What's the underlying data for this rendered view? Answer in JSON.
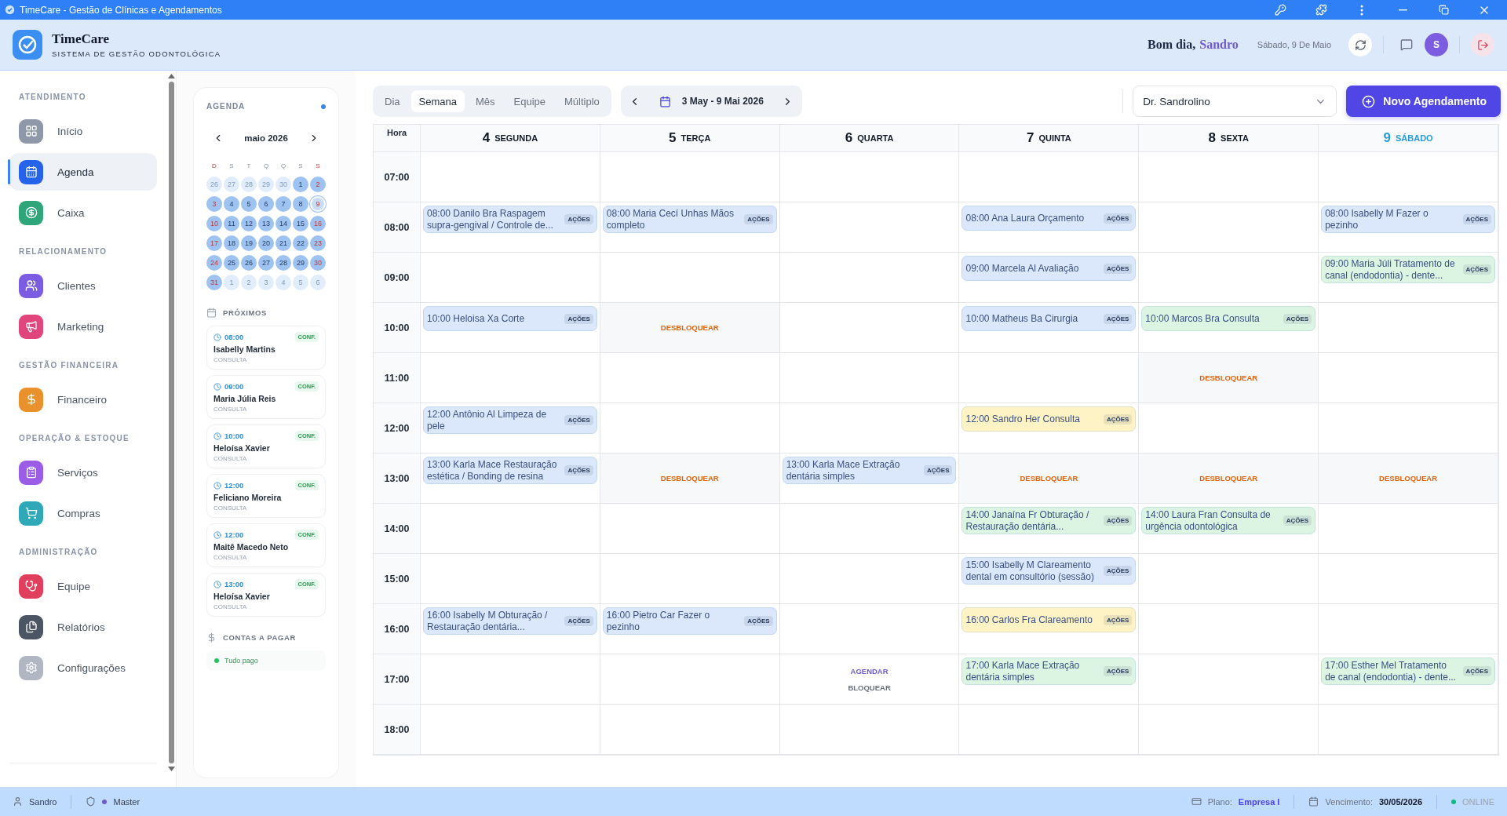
{
  "window": {
    "title": "TimeCare - Gestão de Clínicas e Agendamentos"
  },
  "header": {
    "app_name": "TimeCare",
    "subtitle": "SISTEMA DE GESTÃO ODONTOLÓGICA",
    "greeting": "Bom dia,",
    "user_name": "Sandro",
    "date": "Sábado, 9 De Maio",
    "avatar_initial": "S"
  },
  "sidebar": {
    "sections": [
      {
        "label": "ATENDIMENTO",
        "items": [
          {
            "label": "Início",
            "color": "#8e98a8",
            "selected": false
          },
          {
            "label": "Agenda",
            "color": "#2563eb",
            "selected": true
          },
          {
            "label": "Caixa",
            "color": "#2fa67a",
            "selected": false
          }
        ]
      },
      {
        "label": "RELACIONAMENTO",
        "items": [
          {
            "label": "Clientes",
            "color": "#7c5ce0",
            "selected": false
          },
          {
            "label": "Marketing",
            "color": "#e0457b",
            "selected": false
          }
        ]
      },
      {
        "label": "GESTÃO FINANCEIRA",
        "items": [
          {
            "label": "Financeiro",
            "color": "#e8912d",
            "selected": false
          }
        ]
      },
      {
        "label": "OPERAÇÃO & ESTOQUE",
        "items": [
          {
            "label": "Serviços",
            "color": "#9b5de5",
            "selected": false
          },
          {
            "label": "Compras",
            "color": "#2fa8b8",
            "selected": false
          }
        ]
      },
      {
        "label": "ADMINISTRAÇÃO",
        "items": [
          {
            "label": "Equipe",
            "color": "#e0405e",
            "selected": false
          },
          {
            "label": "Relatórios",
            "color": "#4b5563",
            "selected": false
          },
          {
            "label": "Configurações",
            "color": "#b0b7c3",
            "selected": false
          }
        ]
      }
    ]
  },
  "agenda_panel": {
    "title": "AGENDA",
    "month": "maio 2026",
    "weekdays": [
      "D",
      "S",
      "T",
      "Q",
      "Q",
      "S",
      "S"
    ],
    "weeks": [
      [
        {
          "day": "26",
          "muted": true,
          "selected": false
        },
        {
          "day": "27",
          "muted": true,
          "selected": false
        },
        {
          "day": "28",
          "muted": true,
          "selected": false
        },
        {
          "day": "29",
          "muted": true,
          "selected": false
        },
        {
          "day": "30",
          "muted": true,
          "selected": false
        },
        {
          "day": "1",
          "muted": false,
          "selected": false
        },
        {
          "day": "2",
          "muted": false,
          "selected": false
        }
      ],
      [
        {
          "day": "3",
          "muted": false,
          "selected": false
        },
        {
          "day": "4",
          "muted": false,
          "selected": false
        },
        {
          "day": "5",
          "muted": false,
          "selected": false
        },
        {
          "day": "6",
          "muted": false,
          "selected": false
        },
        {
          "day": "7",
          "muted": false,
          "selected": false
        },
        {
          "day": "8",
          "muted": false,
          "selected": false
        },
        {
          "day": "9",
          "muted": false,
          "selected": true
        }
      ],
      [
        {
          "day": "10",
          "muted": false,
          "selected": false
        },
        {
          "day": "11",
          "muted": false,
          "selected": false
        },
        {
          "day": "12",
          "muted": false,
          "selected": false
        },
        {
          "day": "13",
          "muted": false,
          "selected": false
        },
        {
          "day": "14",
          "muted": false,
          "selected": false
        },
        {
          "day": "15",
          "muted": false,
          "selected": false
        },
        {
          "day": "16",
          "muted": false,
          "selected": false
        }
      ],
      [
        {
          "day": "17",
          "muted": false,
          "selected": false
        },
        {
          "day": "18",
          "muted": false,
          "selected": false
        },
        {
          "day": "19",
          "muted": false,
          "selected": false
        },
        {
          "day": "20",
          "muted": false,
          "selected": false
        },
        {
          "day": "21",
          "muted": false,
          "selected": false
        },
        {
          "day": "22",
          "muted": false,
          "selected": false
        },
        {
          "day": "23",
          "muted": false,
          "selected": false
        }
      ],
      [
        {
          "day": "24",
          "muted": false,
          "selected": false
        },
        {
          "day": "25",
          "muted": false,
          "selected": false
        },
        {
          "day": "26",
          "muted": false,
          "selected": false
        },
        {
          "day": "27",
          "muted": false,
          "selected": false
        },
        {
          "day": "28",
          "muted": false,
          "selected": false
        },
        {
          "day": "29",
          "muted": false,
          "selected": false
        },
        {
          "day": "30",
          "muted": false,
          "selected": false
        }
      ],
      [
        {
          "day": "31",
          "muted": false,
          "selected": false
        },
        {
          "day": "1",
          "muted": true,
          "selected": false
        },
        {
          "day": "2",
          "muted": true,
          "selected": false
        },
        {
          "day": "3",
          "muted": true,
          "selected": false
        },
        {
          "day": "4",
          "muted": true,
          "selected": false
        },
        {
          "day": "5",
          "muted": true,
          "selected": false
        },
        {
          "day": "6",
          "muted": true,
          "selected": false
        }
      ]
    ],
    "upcoming_title": "PRÓXIMOS",
    "upcoming": [
      {
        "time": "08:00",
        "status": "CONF.",
        "name": "Isabelly Martins",
        "type": "CONSULTA"
      },
      {
        "time": "09:00",
        "status": "CONF.",
        "name": "Maria Júlia Reis",
        "type": "CONSULTA"
      },
      {
        "time": "10:00",
        "status": "CONF.",
        "name": "Heloísa Xavier",
        "type": "CONSULTA"
      },
      {
        "time": "12:00",
        "status": "CONF.",
        "name": "Feliciano Moreira",
        "type": "CONSULTA"
      },
      {
        "time": "12:00",
        "status": "CONF.",
        "name": "Maitê Macedo Neto",
        "type": "CONSULTA"
      },
      {
        "time": "13:00",
        "status": "CONF.",
        "name": "Heloísa Xavier",
        "type": "CONSULTA"
      }
    ],
    "bills_title": "CONTAS A PAGAR",
    "bills_status": "Tudo pago"
  },
  "toolbar": {
    "views": [
      {
        "label": "Dia",
        "selected": false
      },
      {
        "label": "Semana",
        "selected": true
      },
      {
        "label": "Mês",
        "selected": false
      },
      {
        "label": "Equipe",
        "selected": false
      },
      {
        "label": "Múltiplo",
        "selected": false
      }
    ],
    "date_range": "3 May - 9 Mai 2026",
    "professional": "Dr. Sandrolino",
    "new_button": "Novo Agendamento"
  },
  "calendar": {
    "hour_header": "Hora",
    "days": [
      {
        "number": "4",
        "name": "SEGUNDA",
        "selected": false
      },
      {
        "number": "5",
        "name": "TERÇA",
        "selected": false
      },
      {
        "number": "6",
        "name": "QUARTA",
        "selected": false
      },
      {
        "number": "7",
        "name": "QUINTA",
        "selected": false
      },
      {
        "number": "8",
        "name": "SEXTA",
        "selected": false
      },
      {
        "number": "9",
        "name": "SÁBADO",
        "selected": true
      }
    ],
    "rows": [
      {
        "hour": "07:00",
        "cells": [
          {
            "kind": "empty"
          },
          {
            "kind": "empty"
          },
          {
            "kind": "empty"
          },
          {
            "kind": "empty"
          },
          {
            "kind": "empty"
          },
          {
            "kind": "empty"
          }
        ]
      },
      {
        "hour": "08:00",
        "cells": [
          {
            "kind": "appointment",
            "text": "08:00 Danilo Bra Raspagem supra-gengival / Controle de...",
            "action": "AÇÕES",
            "color": "#dbe8fb"
          },
          {
            "kind": "appointment",
            "text": "08:00 Maria Cecí Unhas Mãos completo",
            "action": "AÇÕES",
            "color": "#dbe8fb"
          },
          {
            "kind": "empty"
          },
          {
            "kind": "appointment",
            "text": "08:00 Ana Laura Orçamento",
            "action": "AÇÕES",
            "color": "#dbe8fb"
          },
          {
            "kind": "empty"
          },
          {
            "kind": "appointment",
            "text": "08:00 Isabelly M Fazer o pezinho",
            "action": "AÇÕES",
            "color": "#dbe8fb"
          }
        ]
      },
      {
        "hour": "09:00",
        "cells": [
          {
            "kind": "empty"
          },
          {
            "kind": "empty"
          },
          {
            "kind": "empty"
          },
          {
            "kind": "appointment",
            "text": "09:00 Marcela Al Avaliação",
            "action": "AÇÕES",
            "color": "#dbe8fb"
          },
          {
            "kind": "empty"
          },
          {
            "kind": "appointment",
            "text": "09:00 Maria Júli Tratamento de canal (endodontia) - dente...",
            "action": "AÇÕES",
            "color": "#dcf5e3"
          }
        ]
      },
      {
        "hour": "10:00",
        "cells": [
          {
            "kind": "appointment",
            "text": "10:00 Heloisa Xa Corte",
            "action": "AÇÕES",
            "color": "#dbe8fb"
          },
          {
            "kind": "blocked",
            "action": "DESBLOQUEAR"
          },
          {
            "kind": "empty"
          },
          {
            "kind": "appointment",
            "text": "10:00 Matheus Ba Cirurgia",
            "action": "AÇÕES",
            "color": "#dbe8fb"
          },
          {
            "kind": "appointment",
            "text": "10:00 Marcos Bra Consulta",
            "action": "AÇÕES",
            "color": "#dcf5e3"
          },
          {
            "kind": "empty"
          }
        ]
      },
      {
        "hour": "11:00",
        "cells": [
          {
            "kind": "empty"
          },
          {
            "kind": "empty"
          },
          {
            "kind": "empty"
          },
          {
            "kind": "empty"
          },
          {
            "kind": "blocked",
            "action": "DESBLOQUEAR"
          },
          {
            "kind": "empty"
          }
        ]
      },
      {
        "hour": "12:00",
        "cells": [
          {
            "kind": "appointment",
            "text": "12:00 Antônio Al Limpeza de pele",
            "action": "AÇÕES",
            "color": "#dbe8fb"
          },
          {
            "kind": "empty"
          },
          {
            "kind": "empty"
          },
          {
            "kind": "appointment",
            "text": "12:00 Sandro Her Consulta",
            "action": "AÇÕES",
            "color": "#fdf3c4"
          },
          {
            "kind": "empty"
          },
          {
            "kind": "empty"
          }
        ]
      },
      {
        "hour": "13:00",
        "cells": [
          {
            "kind": "appointment",
            "text": "13:00 Karla Mace Restauração estética / Bonding de resina",
            "action": "AÇÕES",
            "color": "#dbe8fb"
          },
          {
            "kind": "blocked",
            "action": "DESBLOQUEAR"
          },
          {
            "kind": "appointment",
            "text": "13:00 Karla Mace Extração dentária simples",
            "action": "AÇÕES",
            "color": "#dbe8fb"
          },
          {
            "kind": "blocked",
            "action": "DESBLOQUEAR"
          },
          {
            "kind": "blocked",
            "action": "DESBLOQUEAR"
          },
          {
            "kind": "blocked",
            "action": "DESBLOQUEAR"
          }
        ]
      },
      {
        "hour": "14:00",
        "cells": [
          {
            "kind": "empty"
          },
          {
            "kind": "empty"
          },
          {
            "kind": "empty"
          },
          {
            "kind": "appointment",
            "text": "14:00 Janaína Fr Obturação / Restauração dentária...",
            "action": "AÇÕES",
            "color": "#dcf5e3"
          },
          {
            "kind": "appointment",
            "text": "14:00 Laura Fran Consulta de urgência odontológica",
            "action": "AÇÕES",
            "color": "#dcf5e3"
          },
          {
            "kind": "empty"
          }
        ]
      },
      {
        "hour": "15:00",
        "cells": [
          {
            "kind": "empty"
          },
          {
            "kind": "empty"
          },
          {
            "kind": "empty"
          },
          {
            "kind": "appointment",
            "text": "15:00 Isabelly M Clareamento dental em consultório (sessão)",
            "action": "AÇÕES",
            "color": "#dbe8fb"
          },
          {
            "kind": "empty"
          },
          {
            "kind": "empty"
          }
        ]
      },
      {
        "hour": "16:00",
        "cells": [
          {
            "kind": "appointment",
            "text": "16:00 Isabelly M Obturação / Restauração dentária...",
            "action": "AÇÕES",
            "color": "#dbe8fb"
          },
          {
            "kind": "appointment",
            "text": "16:00 Pietro Car Fazer o pezinho",
            "action": "AÇÕES",
            "color": "#dbe8fb"
          },
          {
            "kind": "empty"
          },
          {
            "kind": "appointment",
            "text": "16:00 Carlos Fra Clareamento",
            "action": "AÇÕES",
            "color": "#fdf3c4"
          },
          {
            "kind": "empty"
          },
          {
            "kind": "empty"
          }
        ]
      },
      {
        "hour": "17:00",
        "cells": [
          {
            "kind": "empty"
          },
          {
            "kind": "empty"
          },
          {
            "kind": "slot_actions",
            "actions": [
              "AGENDAR",
              "BLOQUEAR"
            ]
          },
          {
            "kind": "appointment",
            "text": "17:00 Karla Mace Extração dentária simples",
            "action": "AÇÕES",
            "color": "#dcf5e3"
          },
          {
            "kind": "empty"
          },
          {
            "kind": "appointment",
            "text": "17:00 Esther Mel Tratamento de canal (endodontia) - dente...",
            "action": "AÇÕES",
            "color": "#dcf5e3"
          }
        ]
      },
      {
        "hour": "18:00",
        "cells": [
          {
            "kind": "empty"
          },
          {
            "kind": "empty"
          },
          {
            "kind": "empty"
          },
          {
            "kind": "empty"
          },
          {
            "kind": "empty"
          },
          {
            "kind": "empty"
          }
        ]
      }
    ]
  },
  "status_bar": {
    "user": "Sandro",
    "role": "Master",
    "plan_label": "Plano:",
    "plan": "Empresa I",
    "due_label": "Vencimento:",
    "due_date": "30/05/2026",
    "connection": "ONLINE"
  }
}
